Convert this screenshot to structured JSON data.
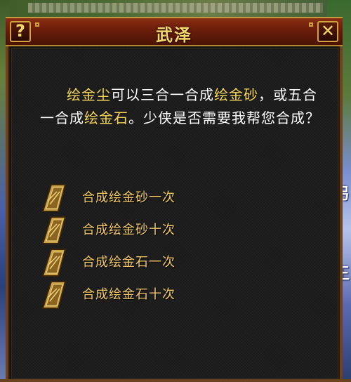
{
  "dialog": {
    "title": "武泽",
    "help_label": "?",
    "close_label": "✕"
  },
  "message": {
    "item1": "绘金尘",
    "text1": "可以三合一合成",
    "item2": "绘金砂",
    "text2": "，或五合一合成",
    "item3": "绘金石",
    "text3": "。少侠是否需要我帮您合成？"
  },
  "options": [
    {
      "label": "合成绘金砂一次"
    },
    {
      "label": "合成绘金砂十次"
    },
    {
      "label": "合成绘金石一次"
    },
    {
      "label": "合成绘金石十次"
    }
  ],
  "background": {
    "right_glyph_1": "另",
    "right_glyph_2": "王"
  },
  "colors": {
    "title": "#f2d86a",
    "highlight": "#f6d65a",
    "option_text": "#f2c96a",
    "frame": "#6b4220"
  }
}
